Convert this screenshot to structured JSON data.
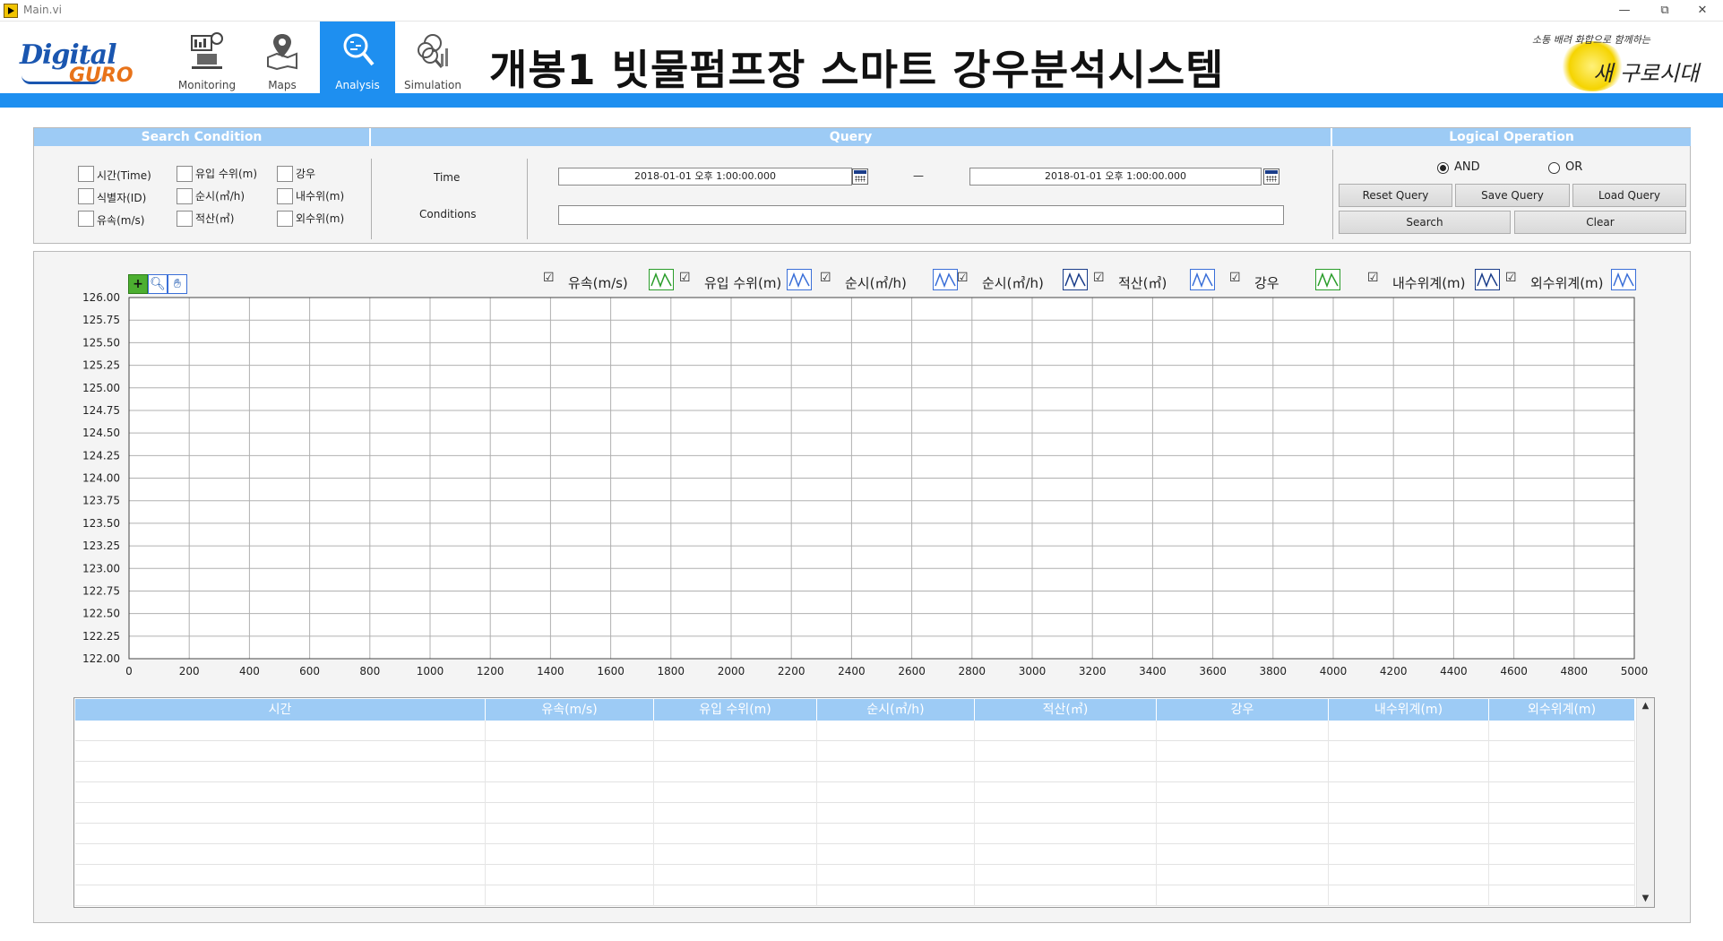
{
  "window": {
    "title": "Main.vi",
    "controls": {
      "minimize": "—",
      "maximize": "⧉",
      "close": "✕"
    }
  },
  "header": {
    "logo": {
      "line1": "Digital",
      "line2": "GURO"
    },
    "title": "개봉1 빗물펌프장 스마트 강우분석시스템",
    "district_logo": {
      "slogan_top": "소통 배려 화합으로 함께하는",
      "slogan_main": "새 구로시대"
    },
    "tabs": [
      {
        "label": "Monitoring",
        "icon": "monitoring-icon",
        "active": false
      },
      {
        "label": "Maps",
        "icon": "map-pin-icon",
        "active": false
      },
      {
        "label": "Analysis",
        "icon": "analysis-icon",
        "active": true
      },
      {
        "label": "Simulation",
        "icon": "simulation-icon",
        "active": false
      }
    ],
    "accent_color": "#1e8ff0"
  },
  "search_condition": {
    "heading": "Search Condition",
    "checkboxes": [
      {
        "label": "시간(Time)",
        "checked": false
      },
      {
        "label": "식별자(ID)",
        "checked": false
      },
      {
        "label": "유속(m/s)",
        "checked": false
      },
      {
        "label": "유입 수위(m)",
        "checked": false
      },
      {
        "label": "순시(㎥/h)",
        "checked": false
      },
      {
        "label": "적산(㎥)",
        "checked": false
      },
      {
        "label": "강우",
        "checked": false
      },
      {
        "label": "내수위(m)",
        "checked": false
      },
      {
        "label": "외수위(m)",
        "checked": false
      }
    ]
  },
  "query": {
    "heading": "Query",
    "time_label": "Time",
    "conditions_label": "Conditions",
    "start_time": "2018-01-01  오후 1:00:00.000",
    "range_separator": "—",
    "end_time": "2018-01-01  오후 1:00:00.000",
    "conditions_value": ""
  },
  "logical_operation": {
    "heading": "Logical Operation",
    "and_label": "AND",
    "or_label": "OR",
    "selected": "AND",
    "buttons": {
      "reset_query": "Reset Query",
      "save_query": "Save Query",
      "load_query": "Load Query",
      "search": "Search",
      "clear": "Clear"
    }
  },
  "legend": [
    {
      "name": "유속(m/s)",
      "checked": true,
      "plot_icon": "line-plot-icon",
      "color": "#2a9d2a"
    },
    {
      "name": "유입 수위(m)",
      "checked": true,
      "plot_icon": "line-plot-icon",
      "color": "#3a6fd8"
    },
    {
      "name": "순시(㎥/h)",
      "checked": true,
      "plot_icon": "line-plot-icon",
      "color": "#3a6fd8"
    },
    {
      "name": "순시(㎥/h)",
      "checked": true,
      "plot_icon": "line-plot-icon",
      "color": "#1a3d8a"
    },
    {
      "name": "적산(㎥)",
      "checked": true,
      "plot_icon": "line-plot-icon",
      "color": "#3a6fd8"
    },
    {
      "name": "강우",
      "checked": true,
      "plot_icon": "line-plot-icon",
      "color": "#2a9d2a"
    },
    {
      "name": "내수위계(m)",
      "checked": true,
      "plot_icon": "line-plot-icon",
      "color": "#1a3d8a"
    },
    {
      "name": "외수위계(m)",
      "checked": true,
      "plot_icon": "line-plot-icon",
      "color": "#3a6fd8"
    }
  ],
  "chart_data": {
    "type": "line",
    "title": "",
    "xlabel": "",
    "ylabel": "",
    "xlim": [
      0,
      5000
    ],
    "ylim": [
      122,
      126
    ],
    "x_ticks": [
      0,
      200,
      400,
      600,
      800,
      1000,
      1200,
      1400,
      1600,
      1800,
      2000,
      2200,
      2400,
      2600,
      2800,
      3000,
      3200,
      3400,
      3600,
      3800,
      4000,
      4200,
      4400,
      4600,
      4800,
      5000
    ],
    "y_ticks": [
      "126.00",
      "125.75",
      "125.50",
      "125.25",
      "125.00",
      "124.75",
      "124.50",
      "124.25",
      "124.00",
      "123.75",
      "123.50",
      "123.25",
      "123.00",
      "122.75",
      "122.50",
      "122.25",
      "122.00"
    ],
    "grid": true,
    "series": []
  },
  "table": {
    "columns": [
      "시간",
      "유속(m/s)",
      "유입 수위(m)",
      "순시(㎥/h)",
      "적산(㎥)",
      "강우",
      "내수위계(m)",
      "외수위계(m)"
    ],
    "rows": [],
    "empty_row_count": 9
  }
}
